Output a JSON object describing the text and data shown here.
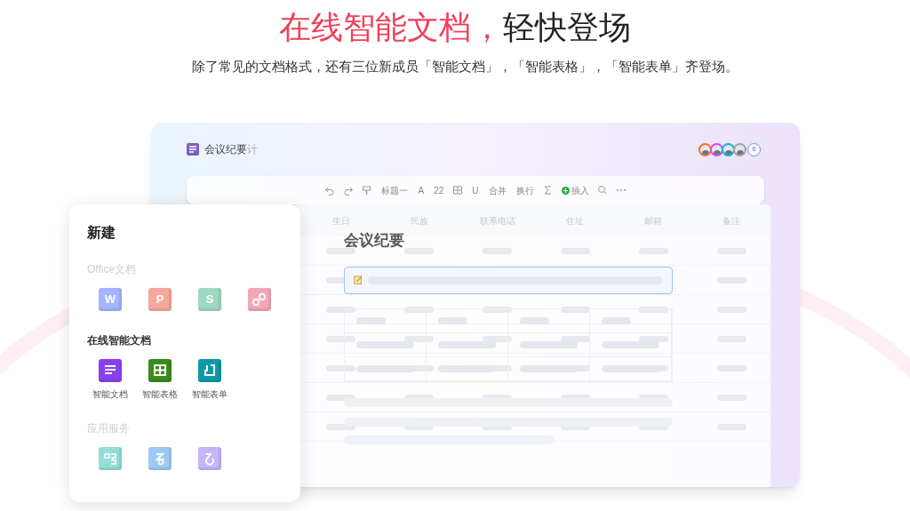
{
  "headline": {
    "accent": "在线智能文档，",
    "rest": "轻快登场"
  },
  "subtitle": "除了常见的文档格式，还有三位新成员「智能文档」，「智能表格」，「智能表单」齐登场。",
  "document": {
    "title": "会议纪要",
    "title_suffix": "计",
    "avatars": [
      {
        "color": "#f97316"
      },
      {
        "color": "#d946ef"
      },
      {
        "color": "#06b6d4"
      },
      {
        "color": "#9ca3af"
      }
    ],
    "collaborator_count": "6",
    "toolbar": [
      {
        "kind": "undo"
      },
      {
        "kind": "redo"
      },
      {
        "kind": "painter"
      },
      {
        "kind": "text",
        "label": "标题一"
      },
      {
        "kind": "text",
        "label": "A"
      },
      {
        "kind": "text",
        "label": "22"
      },
      {
        "kind": "table"
      },
      {
        "kind": "text",
        "label": "U"
      },
      {
        "kind": "text",
        "label": "合并"
      },
      {
        "kind": "text",
        "label": "换行"
      },
      {
        "kind": "sigma"
      },
      {
        "kind": "insert",
        "label": "插入"
      },
      {
        "kind": "search"
      },
      {
        "kind": "more"
      }
    ],
    "table_columns": [
      "生日",
      "民族",
      "联系电话",
      "住址",
      "邮箱",
      "备注"
    ],
    "heading": "会议纪要"
  },
  "new_panel": {
    "title": "新建",
    "sections": [
      {
        "title": "Office文档",
        "muted": true,
        "items": [
          {
            "kind": "letter",
            "glyph": "W",
            "color": "#a5b4fc"
          },
          {
            "kind": "letter",
            "glyph": "P",
            "color": "#f4a99a"
          },
          {
            "kind": "letter",
            "glyph": "S",
            "color": "#9fd8c2"
          },
          {
            "kind": "link",
            "color": "#f4a7b9"
          }
        ]
      },
      {
        "title": "在线智能文档",
        "muted": false,
        "items": [
          {
            "kind": "doc",
            "color": "#8b3ff0",
            "label": "智能文档"
          },
          {
            "kind": "sheet",
            "color": "#3b8a1c",
            "label": "智能表格"
          },
          {
            "kind": "form",
            "color": "#0e9aa7",
            "label": "智能表单"
          }
        ]
      },
      {
        "title": "应用服务",
        "muted": true,
        "items": [
          {
            "kind": "flow",
            "color": "#93dcd8"
          },
          {
            "kind": "mind",
            "color": "#9ccaf5"
          },
          {
            "kind": "app",
            "color": "#c4b5fd"
          }
        ]
      }
    ]
  }
}
